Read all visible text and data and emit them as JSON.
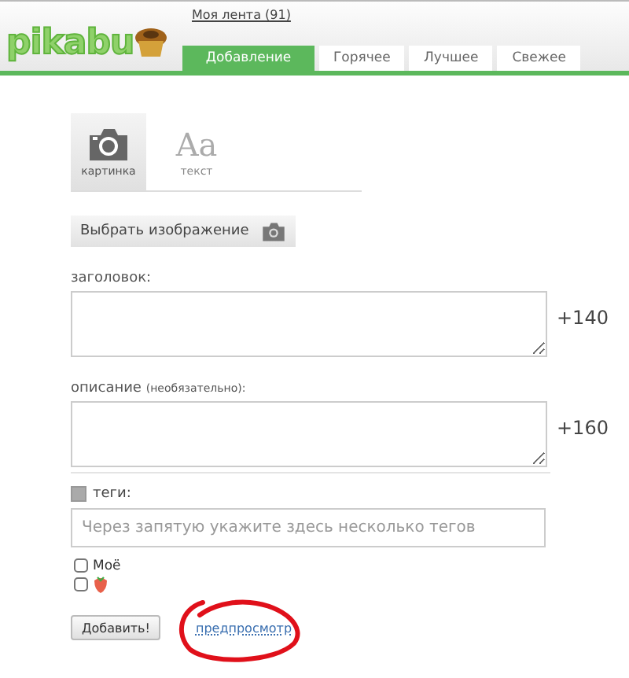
{
  "header": {
    "logo": "pikabu",
    "feed_link": "Моя лента (91)",
    "tabs": [
      {
        "label": "Добавление",
        "selected": true
      },
      {
        "label": "Горячее",
        "selected": false
      },
      {
        "label": "Лучшее",
        "selected": false
      },
      {
        "label": "Свежее",
        "selected": false
      }
    ]
  },
  "post_types": [
    {
      "kind": "camera",
      "label": "картинка",
      "selected": true
    },
    {
      "kind": "letters",
      "glyph": "Aa",
      "label": "текст",
      "selected": false
    }
  ],
  "choose_image_button": "Выбрать изображение",
  "fields": [
    {
      "label": "заголовок:",
      "counter": "+140"
    },
    {
      "label": "описание",
      "note": "(необязательно):",
      "counter": "+160"
    }
  ],
  "tags": {
    "label": "теги:",
    "placeholder": "Через запятую укажите здесь несколько тегов"
  },
  "options": [
    {
      "kind": "text",
      "label": "Моё",
      "checked": false
    },
    {
      "kind": "strawberry",
      "checked": false
    }
  ],
  "submit_button": "Добавить!",
  "preview_link": "предпросмотр",
  "annotation": {
    "kind": "red-circle"
  }
}
